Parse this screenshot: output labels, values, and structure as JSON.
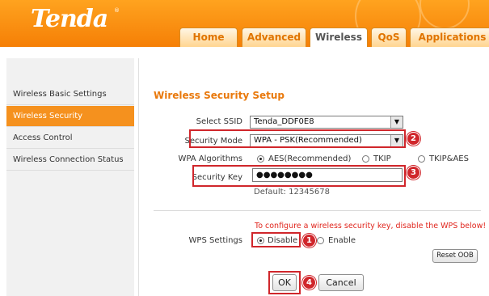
{
  "header": {
    "logo": "Tenda",
    "logo_mark": "®",
    "tabs": [
      "Home",
      "Advanced",
      "Wireless",
      "QoS",
      "Applications"
    ]
  },
  "sidebar": {
    "items": [
      {
        "label": "Wireless Basic Settings"
      },
      {
        "label": "Wireless Security"
      },
      {
        "label": "Access Control"
      },
      {
        "label": "Wireless Connection Status"
      }
    ]
  },
  "main": {
    "title": "Wireless Security Setup",
    "ssid": {
      "label": "Select SSID",
      "value": "Tenda_DDF0E8"
    },
    "mode": {
      "label": "Security Mode",
      "value": "WPA - PSK(Recommended)"
    },
    "algo": {
      "label": "WPA Algorithms",
      "options": [
        "AES(Recommended)",
        "TKIP",
        "TKIP&AES"
      ],
      "selected": "AES(Recommended)"
    },
    "key": {
      "label": "Security Key",
      "value": "●●●●●●●●",
      "default_text": "Default: 12345678"
    },
    "warning": "To configure a wireless security key, disable the WPS below!",
    "wps": {
      "label": "WPS Settings",
      "options": [
        "Disable",
        "Enable"
      ],
      "selected": "Disable"
    },
    "reset_label": "Reset OOB",
    "ok_label": "OK",
    "cancel_label": "Cancel"
  },
  "annotations": {
    "badges": [
      "1",
      "2",
      "3",
      "4"
    ]
  },
  "colors": {
    "brand_orange": "#f5911e",
    "title_orange": "#e9790c",
    "highlight_red": "#d0262b",
    "warning_red": "#e0261e"
  }
}
